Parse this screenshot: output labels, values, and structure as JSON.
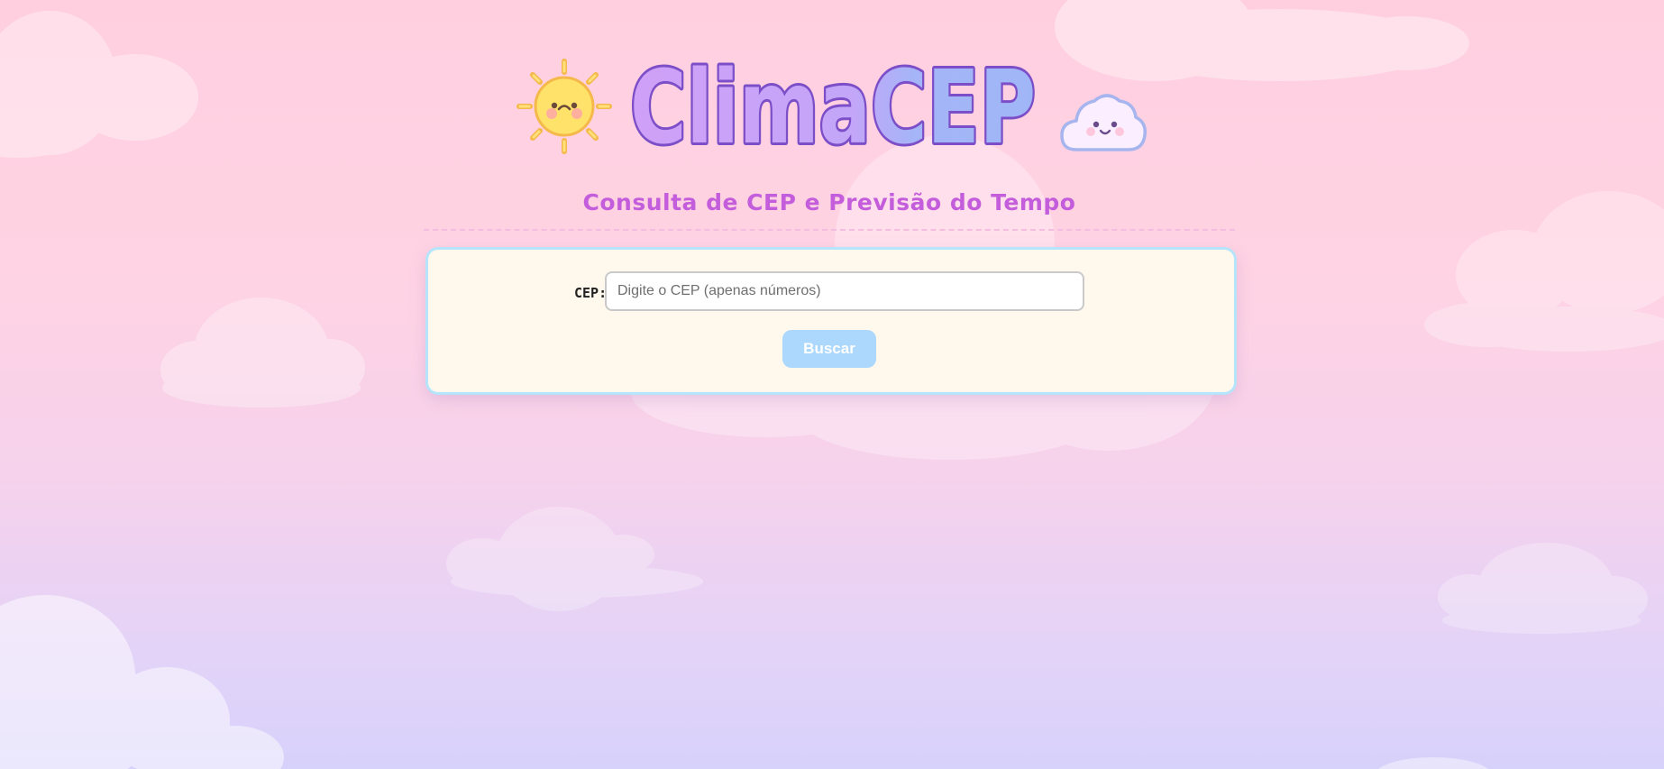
{
  "app": {
    "logo_text": "ClimaCEP",
    "subtitle": "Consulta de CEP e Previsão do Tempo"
  },
  "form": {
    "cep_label": "CEP:",
    "cep_value": "",
    "cep_placeholder": "Digite o CEP (apenas números)",
    "search_button_label": "Buscar"
  },
  "icons": {
    "left": "sun-icon",
    "right": "cloud-face-icon"
  },
  "colors": {
    "subtitle": "#c45ddc",
    "logo_fill_start": "#cfa0f7",
    "logo_fill_end": "#9fb6f6",
    "logo_outline": "#7c4fc9",
    "card_background": "#fff9ed",
    "card_border": "#b6e4fa",
    "button_background": "#acd8fd",
    "sun": "#ffe26a"
  }
}
